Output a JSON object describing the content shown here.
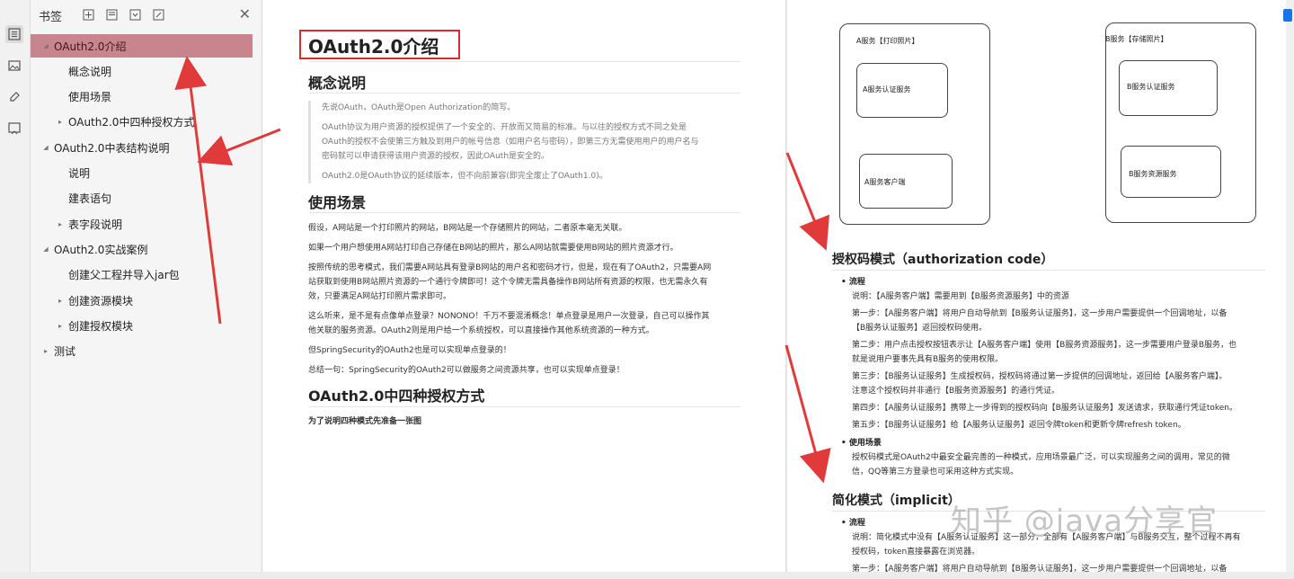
{
  "sidebar": {
    "title": "书签",
    "tools": [
      "bookmark-add-icon",
      "bookmark-collapse-icon",
      "bookmark-expand-icon",
      "bookmark-edit-icon"
    ],
    "close": "close-icon",
    "items": [
      {
        "label": "OAuth2.0介绍",
        "level": 0,
        "toggle": "expanded",
        "selected": true
      },
      {
        "label": "概念说明",
        "level": 1,
        "toggle": "none"
      },
      {
        "label": "使用场景",
        "level": 1,
        "toggle": "none"
      },
      {
        "label": "OAuth2.0中四种授权方式",
        "level": 1,
        "toggle": "collapsed"
      },
      {
        "label": "OAuth2.0中表结构说明",
        "level": 0,
        "toggle": "expanded"
      },
      {
        "label": "说明",
        "level": 1,
        "toggle": "none"
      },
      {
        "label": "建表语句",
        "level": 1,
        "toggle": "none"
      },
      {
        "label": "表字段说明",
        "level": 1,
        "toggle": "collapsed"
      },
      {
        "label": "OAuth2.0实战案例",
        "level": 0,
        "toggle": "expanded"
      },
      {
        "label": "创建父工程并导入jar包",
        "level": 1,
        "toggle": "none"
      },
      {
        "label": "创建资源模块",
        "level": 1,
        "toggle": "collapsed"
      },
      {
        "label": "创建授权模块",
        "level": 1,
        "toggle": "collapsed"
      },
      {
        "label": "测试",
        "level": 0,
        "toggle": "collapsed"
      }
    ]
  },
  "rail": [
    "bookmarks-icon",
    "thumbnails-icon",
    "annotations-icon",
    "attachments-icon"
  ],
  "left_page": {
    "title": "OAuth2.0介绍",
    "concept_heading": "概念说明",
    "quote": [
      "先说OAuth，OAuth是Open Authorization的简写。",
      "OAuth协议为用户资源的授权提供了一个安全的、开放而又简易的标准。与以往的授权方式不同之处是",
      "OAuth的授权不会使第三方触及到用户的帐号信息（如用户名与密码），即第三方无需使用用户的用户名与",
      "密码就可以申请获得该用户资源的授权，因此OAuth是安全的。",
      "OAuth2.0是OAuth协议的延续版本，但不向前兼容(即完全废止了OAuth1.0)。"
    ],
    "usage_heading": "使用场景",
    "usage": [
      "假设，A网站是一个打印照片的网站，B网站是一个存储照片的网站，二者原本毫无关联。",
      "如果一个用户想使用A网站打印自己存储在B网站的照片，那么A网站就需要使用B网站的照片资源才行。",
      "按照传统的思考模式，我们需要A网站具有登录B网站的用户名和密码才行，但是，现在有了OAuth2，只需要A网",
      "站获取到使用B网站照片资源的一个通行令牌即可！这个令牌无需具备操作B网站所有资源的权限，也无需永久有",
      "效，只要满足A网站打印照片需求即可。",
      "这么听来，是不是有点像单点登录？NONONO！千万不要混淆概念！单点登录是用户一次登录，自己可以操作其",
      "他关联的服务资源。OAuth2则是用户给一个系统授权，可以直接操作其他系统资源的一种方式。",
      "但SpringSecurity的OAuth2也是可以实现单点登录的！",
      "总结一句：SpringSecurity的OAuth2可以做服务之间资源共享，也可以实现单点登录！"
    ],
    "four_heading": "OAuth2.0中四种授权方式",
    "four_note": "为了说明四种模式先准备一张图"
  },
  "right_page": {
    "diagram": {
      "a_title": "A服务【打印照片】",
      "a_auth": "A服务认证服务",
      "a_client": "A服务客户端",
      "b_title": "B服务【存储照片】",
      "b_auth": "B服务认证服务",
      "b_resource": "B服务资源服务"
    },
    "auth_heading": "授权码模式（authorization code）",
    "flow_label": "流程",
    "auth_lines": [
      "说明：【A服务客户端】需要用到【B服务资源服务】中的资源",
      "第一步：【A服务客户端】将用户自动导航到【B服务认证服务】，这一步用户需要提供一个回调地址，以备",
      "【B服务认证服务】返回授权码使用。",
      "第二步：用户点击授权按钮表示让【A服务客户端】使用【B服务资源服务】，这一步需要用户登录B服务，也",
      "就是说用户要事先具有B服务的使用权限。",
      "第三步：【B服务认证服务】生成授权码，授权码将通过第一步提供的回调地址，返回给【A服务客户端】。",
      "注意这个授权码并非通行【B服务资源服务】的通行凭证。",
      "第四步：【A服务认证服务】携带上一步得到的授权码向【B服务认证服务】发送请求，获取通行凭证token。",
      "第五步：【B服务认证服务】给【A服务认证服务】返回令牌token和更新令牌refresh token。"
    ],
    "usage_label": "使用场景",
    "usage_lines": [
      "授权码模式是OAuth2中最安全最完善的一种模式，应用场景最广泛，可以实现服务之间的调用，常见的微",
      "信，QQ等第三方登录也可采用这种方式实现。"
    ],
    "implicit_heading": "简化模式（implicit）",
    "implicit_flow_label": "流程",
    "implicit_lines": [
      "说明：简化模式中没有【A服务认证服务】这一部分，全部有【A服务客户端】与B服务交互，整个过程不再有",
      "授权码，token直接暴露在浏览器。",
      "第一步：【A服务客户端】将用户自动导航到【B服务认证服务】，这一步用户需要提供一个回调地址，以备"
    ]
  },
  "watermark": "知乎 @java分享官",
  "colors": {
    "selected": "#c9858e",
    "annotation": "#e03a3a"
  }
}
